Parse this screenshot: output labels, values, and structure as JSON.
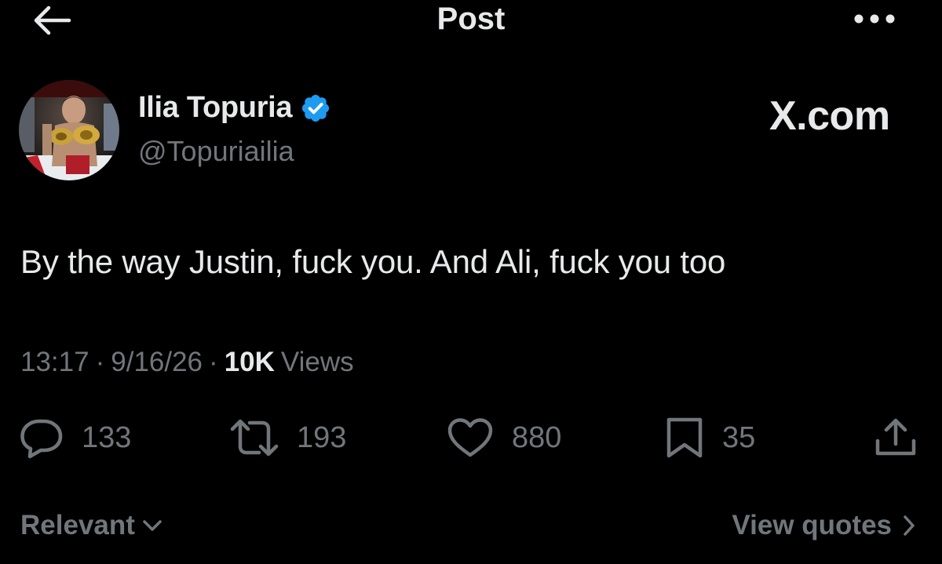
{
  "header": {
    "title": "Post",
    "back_icon": "arrow-left-icon",
    "more_icon": "more-horizontal-icon"
  },
  "author": {
    "name": "Ilia Topuria",
    "handle": "@Topuriailia",
    "verified": true,
    "verified_color": "#1d9bf0"
  },
  "watermark": "X.com",
  "tweet": {
    "text": "By the way Justin, fuck you. And Ali, fuck you too"
  },
  "meta": {
    "time": "13:17",
    "date": "9/16/26",
    "views_count": "10K",
    "views_label": "Views",
    "separator": "·"
  },
  "actions": {
    "replies": "133",
    "reposts": "193",
    "likes": "880",
    "bookmarks": "35"
  },
  "footer": {
    "sort_label": "Relevant",
    "quotes_label": "View quotes"
  },
  "colors": {
    "background": "#000000",
    "primary_text": "#e7e9ea",
    "secondary_text": "#71767b",
    "accent": "#1d9bf0"
  }
}
